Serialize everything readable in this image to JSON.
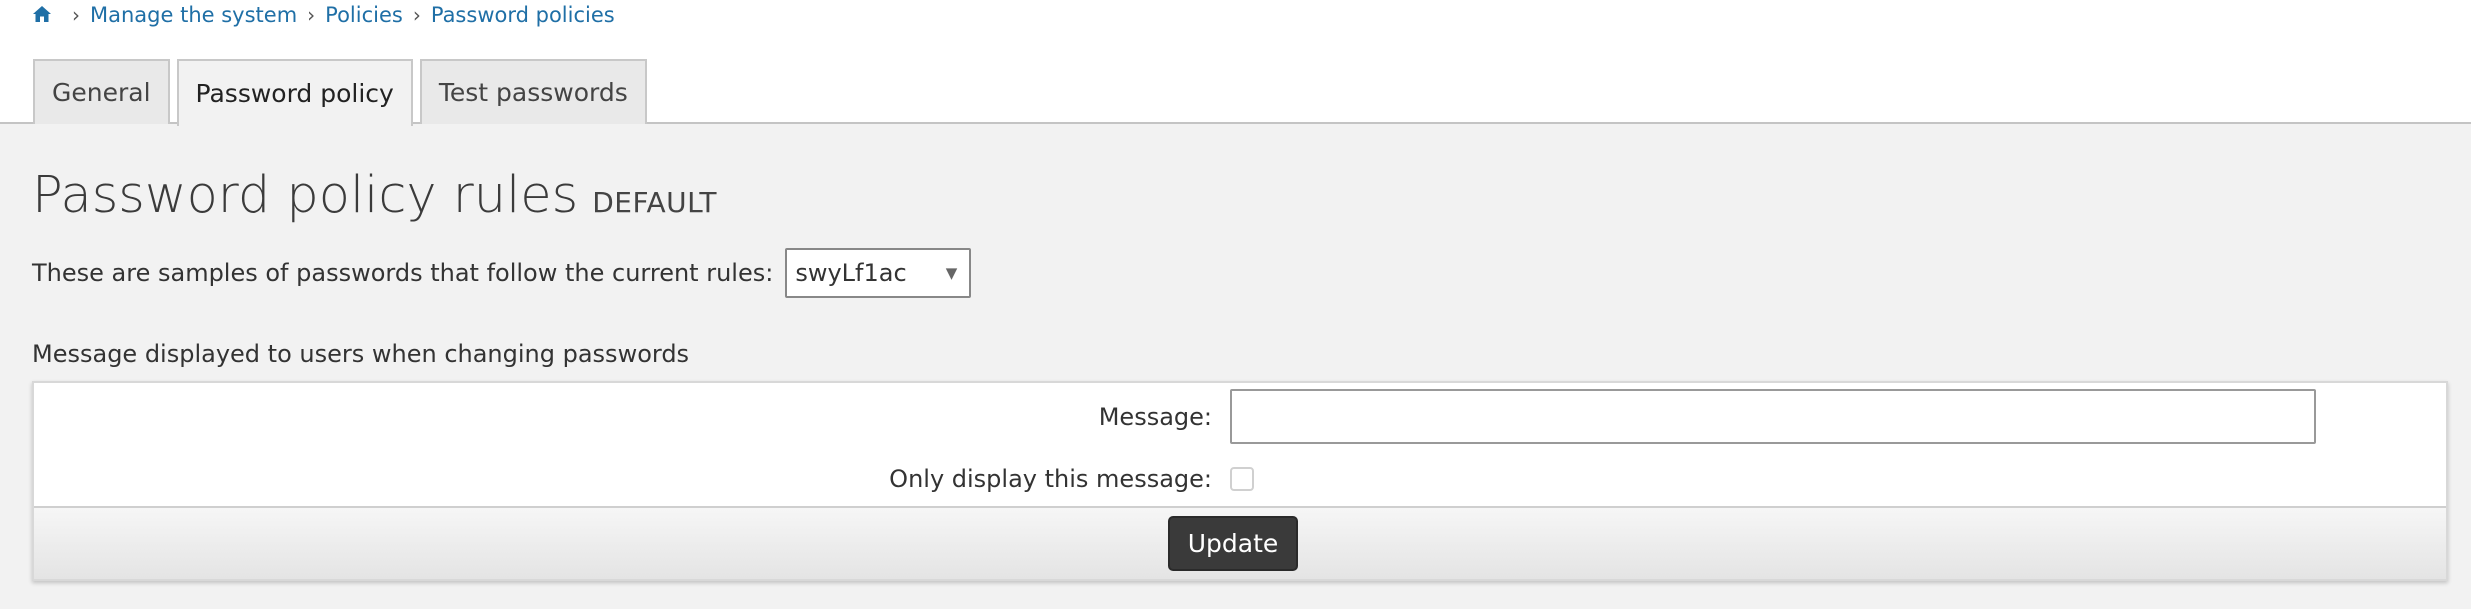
{
  "breadcrumb": {
    "home_icon": "home-icon",
    "items": [
      "Manage the system",
      "Policies",
      "Password policies"
    ],
    "separator": "›"
  },
  "tabs": [
    {
      "label": "General",
      "active": false
    },
    {
      "label": "Password policy",
      "active": true
    },
    {
      "label": "Test passwords",
      "active": false
    }
  ],
  "page": {
    "title": "Password policy rules",
    "title_badge": "DEFAULT"
  },
  "samples": {
    "label": "These are samples of passwords that follow the current rules:",
    "selected": "swyLf1ac",
    "caret": "▼"
  },
  "message_section": {
    "heading": "Message displayed to users when changing passwords",
    "message_label": "Message:",
    "message_value": "",
    "only_display_label": "Only display this message:",
    "only_display_checked": false,
    "update_label": "Update"
  },
  "colors": {
    "link": "#1f6fa6",
    "button_bg": "#3a3a3a",
    "page_bg": "#f2f2f2"
  }
}
